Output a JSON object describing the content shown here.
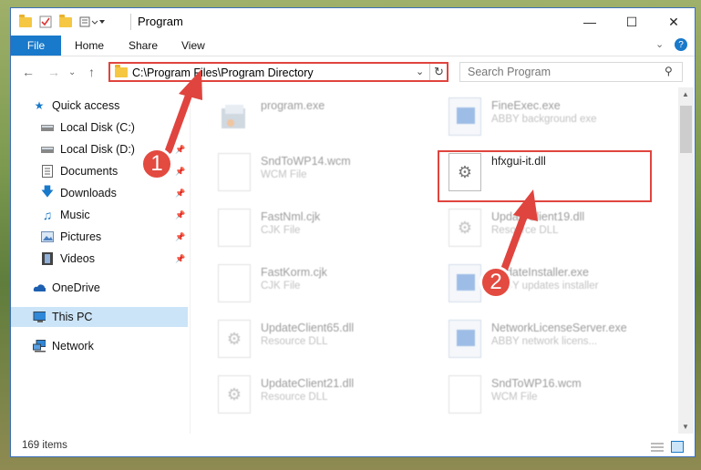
{
  "window": {
    "title": "Program"
  },
  "ribbon": {
    "tabs": [
      "File",
      "Home",
      "Share",
      "View"
    ]
  },
  "address": {
    "path": "C:\\Program Files\\Program Directory"
  },
  "search": {
    "placeholder": "Search Program"
  },
  "sidebar": {
    "items": [
      {
        "label": "Quick access",
        "icon": "star-icon"
      },
      {
        "label": "Local Disk (C:)",
        "icon": "drive-icon"
      },
      {
        "label": "Local Disk (D:)",
        "icon": "drive-icon"
      },
      {
        "label": "Documents",
        "icon": "documents-icon"
      },
      {
        "label": "Downloads",
        "icon": "download-icon"
      },
      {
        "label": "Music",
        "icon": "music-icon"
      },
      {
        "label": "Pictures",
        "icon": "pictures-icon"
      },
      {
        "label": "Videos",
        "icon": "videos-icon"
      },
      {
        "label": "OneDrive",
        "icon": "cloud-icon"
      },
      {
        "label": "This PC",
        "icon": "computer-icon"
      },
      {
        "label": "Network",
        "icon": "network-icon"
      }
    ]
  },
  "files": [
    {
      "name": "program.exe",
      "type": "",
      "icon": "exe"
    },
    {
      "name": "FineExec.exe",
      "type": "ABBY background exe",
      "icon": "exe"
    },
    {
      "name": "SndToWP14.wcm",
      "type": "WCM File",
      "icon": "doc"
    },
    {
      "name": "hfxgui-it.dll",
      "type": "",
      "icon": "dll"
    },
    {
      "name": "FastNml.cjk",
      "type": "CJK File",
      "icon": "doc"
    },
    {
      "name": "UpdateClient19.dll",
      "type": "Resource DLL",
      "icon": "dll"
    },
    {
      "name": "FastKorm.cjk",
      "type": "CJK File",
      "icon": "doc"
    },
    {
      "name": "UpdateInstaller.exe",
      "type": "ABBY updates installer",
      "icon": "exe"
    },
    {
      "name": "UpdateClient65.dll",
      "type": "Resource DLL",
      "icon": "dll"
    },
    {
      "name": "NetworkLicenseServer.exe",
      "type": "ABBY network licens...",
      "icon": "exe"
    },
    {
      "name": "UpdateClient21.dll",
      "type": "Resource DLL",
      "icon": "dll"
    },
    {
      "name": "SndToWP16.wcm",
      "type": "WCM File",
      "icon": "doc"
    }
  ],
  "status": {
    "item_count": "169 items"
  },
  "annotations": {
    "step1": "1",
    "step2": "2"
  },
  "colors": {
    "accent": "#1979ca",
    "highlight": "#e0443e",
    "selected": "#cce4f7"
  }
}
